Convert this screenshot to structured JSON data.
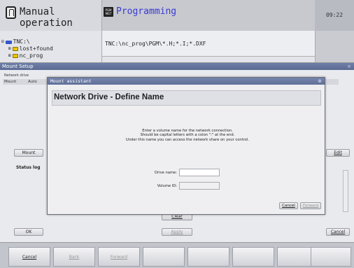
{
  "header": {
    "mode_left": "Manual operation",
    "mode_right": "Programming",
    "pgm_icon_text": [
      "PGM",
      "MGT"
    ],
    "clock": "09:22"
  },
  "file_tree": {
    "items": [
      "TNC:\\",
      "lost+found",
      "nc_prog"
    ]
  },
  "path": {
    "text": "TNC:\\nc_prog\\PGM\\*.H;*.I;*.DXF"
  },
  "mount_setup": {
    "title": "Mount Setup",
    "network_drive_label": "Network drive",
    "columns": [
      "Mount",
      "Auto"
    ],
    "mount_button": "Mount",
    "edit_button": "Edit",
    "status_log_label": "Status log",
    "clear_button": "Clear",
    "apply_button": "Apply",
    "ok_button": "OK",
    "cancel_button": "Cancel"
  },
  "assistant": {
    "title": "Mount assistant",
    "heading": "Network Drive - Define Name",
    "instructions": [
      "Enter a volume name for the network connection.",
      "Should be capital letters with a colon \":\" at the end.",
      "Under this name you can access the network share on your control."
    ],
    "drive_name_label": "Drive name:",
    "drive_name_value": "",
    "volume_id_label": "Volume ID:",
    "volume_id_value": "",
    "cancel_button": "Cancel",
    "forward_button": "Forward"
  },
  "softkeys": [
    "Cancel",
    "Back",
    "Forward",
    "",
    "",
    "",
    "",
    ""
  ]
}
